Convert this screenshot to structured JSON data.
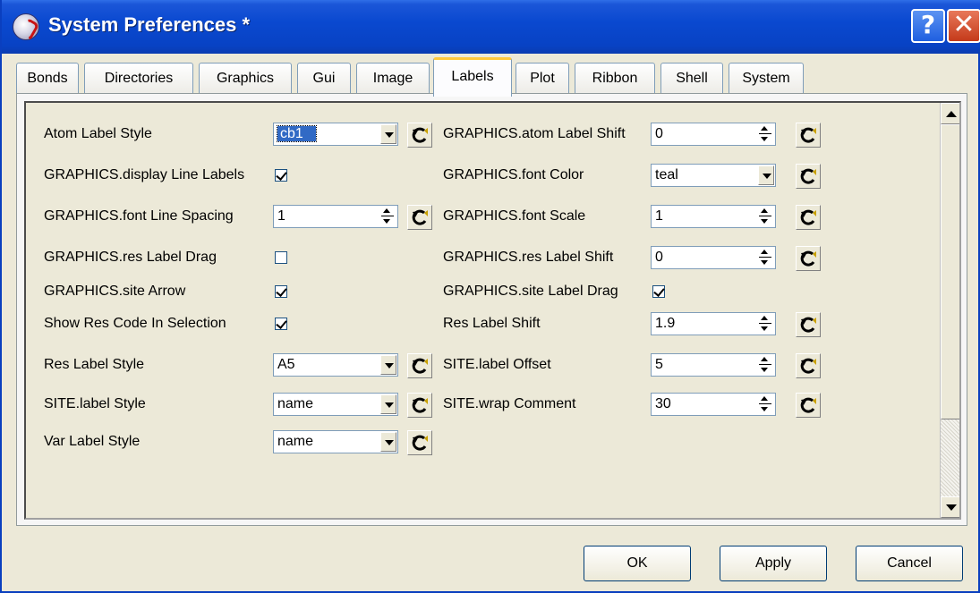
{
  "window": {
    "title": "System Preferences *"
  },
  "tabs": [
    "Bonds",
    "Directories",
    "Graphics",
    "Gui",
    "Image",
    "Labels",
    "Plot",
    "Ribbon",
    "Shell",
    "System"
  ],
  "active_tab": "Labels",
  "left": {
    "atom_label_style": {
      "label": "Atom Label Style",
      "value": "cb1"
    },
    "display_line_labels": {
      "label": "GRAPHICS.display Line Labels",
      "checked": true
    },
    "font_line_spacing": {
      "label": "GRAPHICS.font Line Spacing",
      "value": "1"
    },
    "res_label_drag": {
      "label": "GRAPHICS.res Label Drag",
      "checked": false
    },
    "site_arrow": {
      "label": "GRAPHICS.site Arrow",
      "checked": true
    },
    "show_res_code": {
      "label": "Show Res Code In Selection",
      "checked": true
    },
    "res_label_style": {
      "label": "Res Label Style",
      "value": "A5"
    },
    "site_label_style": {
      "label": "SITE.label Style",
      "value": "name"
    },
    "var_label_style": {
      "label": "Var Label Style",
      "value": "name"
    }
  },
  "right": {
    "atom_label_shift": {
      "label": "GRAPHICS.atom Label Shift",
      "value": "0"
    },
    "font_color": {
      "label": "GRAPHICS.font Color",
      "value": "teal"
    },
    "font_scale": {
      "label": "GRAPHICS.font Scale",
      "value": "1"
    },
    "res_label_shift_g": {
      "label": "GRAPHICS.res Label Shift",
      "value": "0"
    },
    "site_label_drag": {
      "label": "GRAPHICS.site Label Drag",
      "checked": true
    },
    "res_label_shift": {
      "label": "Res Label Shift",
      "value": "1.9"
    },
    "site_label_offset": {
      "label": "SITE.label Offset",
      "value": "5"
    },
    "site_wrap_comment": {
      "label": "SITE.wrap Comment",
      "value": "30"
    }
  },
  "buttons": {
    "ok": "OK",
    "apply": "Apply",
    "cancel": "Cancel"
  },
  "icons": {
    "app": "app-logo-icon",
    "help": "help-icon",
    "close": "close-icon",
    "reset": "reset-arrow-icon",
    "dropdown": "chevron-down-icon",
    "spinner": "spinner-icon"
  },
  "colors": {
    "titlebar": "#0842c4",
    "tab_highlight": "#ffc83c",
    "selection": "#316ac5",
    "close": "#c43a1a"
  }
}
